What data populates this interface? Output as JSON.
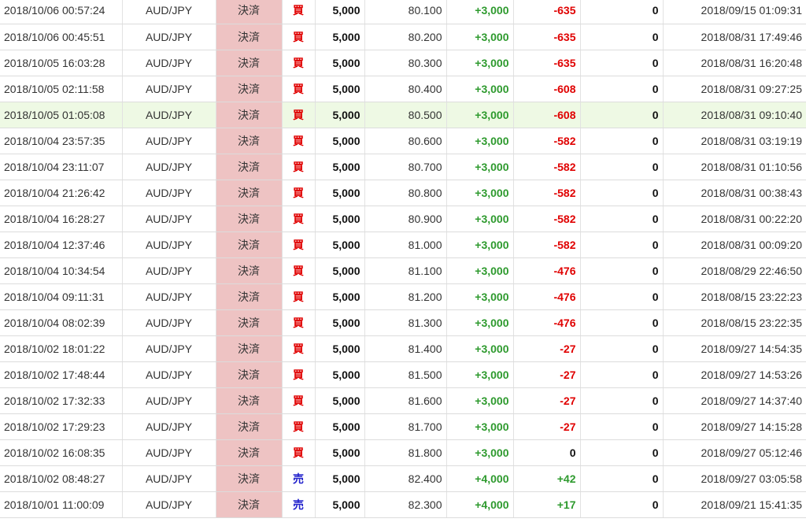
{
  "rows": [
    {
      "time": "2018/10/06 00:57:24",
      "pair": "AUD/JPY",
      "type": "決済",
      "side": "買",
      "qty": "5,000",
      "price": "80.100",
      "pips": "+3,000",
      "pl": "-635",
      "swap": "0",
      "open_time": "2018/09/15 01:09:31"
    },
    {
      "time": "2018/10/06 00:45:51",
      "pair": "AUD/JPY",
      "type": "決済",
      "side": "買",
      "qty": "5,000",
      "price": "80.200",
      "pips": "+3,000",
      "pl": "-635",
      "swap": "0",
      "open_time": "2018/08/31 17:49:46"
    },
    {
      "time": "2018/10/05 16:03:28",
      "pair": "AUD/JPY",
      "type": "決済",
      "side": "買",
      "qty": "5,000",
      "price": "80.300",
      "pips": "+3,000",
      "pl": "-635",
      "swap": "0",
      "open_time": "2018/08/31 16:20:48"
    },
    {
      "time": "2018/10/05 02:11:58",
      "pair": "AUD/JPY",
      "type": "決済",
      "side": "買",
      "qty": "5,000",
      "price": "80.400",
      "pips": "+3,000",
      "pl": "-608",
      "swap": "0",
      "open_time": "2018/08/31 09:27:25"
    },
    {
      "time": "2018/10/05 01:05:08",
      "pair": "AUD/JPY",
      "type": "決済",
      "side": "買",
      "qty": "5,000",
      "price": "80.500",
      "pips": "+3,000",
      "pl": "-608",
      "swap": "0",
      "open_time": "2018/08/31 09:10:40",
      "highlight": true
    },
    {
      "time": "2018/10/04 23:57:35",
      "pair": "AUD/JPY",
      "type": "決済",
      "side": "買",
      "qty": "5,000",
      "price": "80.600",
      "pips": "+3,000",
      "pl": "-582",
      "swap": "0",
      "open_time": "2018/08/31 03:19:19"
    },
    {
      "time": "2018/10/04 23:11:07",
      "pair": "AUD/JPY",
      "type": "決済",
      "side": "買",
      "qty": "5,000",
      "price": "80.700",
      "pips": "+3,000",
      "pl": "-582",
      "swap": "0",
      "open_time": "2018/08/31 01:10:56"
    },
    {
      "time": "2018/10/04 21:26:42",
      "pair": "AUD/JPY",
      "type": "決済",
      "side": "買",
      "qty": "5,000",
      "price": "80.800",
      "pips": "+3,000",
      "pl": "-582",
      "swap": "0",
      "open_time": "2018/08/31 00:38:43"
    },
    {
      "time": "2018/10/04 16:28:27",
      "pair": "AUD/JPY",
      "type": "決済",
      "side": "買",
      "qty": "5,000",
      "price": "80.900",
      "pips": "+3,000",
      "pl": "-582",
      "swap": "0",
      "open_time": "2018/08/31 00:22:20"
    },
    {
      "time": "2018/10/04 12:37:46",
      "pair": "AUD/JPY",
      "type": "決済",
      "side": "買",
      "qty": "5,000",
      "price": "81.000",
      "pips": "+3,000",
      "pl": "-582",
      "swap": "0",
      "open_time": "2018/08/31 00:09:20"
    },
    {
      "time": "2018/10/04 10:34:54",
      "pair": "AUD/JPY",
      "type": "決済",
      "side": "買",
      "qty": "5,000",
      "price": "81.100",
      "pips": "+3,000",
      "pl": "-476",
      "swap": "0",
      "open_time": "2018/08/29 22:46:50"
    },
    {
      "time": "2018/10/04 09:11:31",
      "pair": "AUD/JPY",
      "type": "決済",
      "side": "買",
      "qty": "5,000",
      "price": "81.200",
      "pips": "+3,000",
      "pl": "-476",
      "swap": "0",
      "open_time": "2018/08/15 23:22:23"
    },
    {
      "time": "2018/10/04 08:02:39",
      "pair": "AUD/JPY",
      "type": "決済",
      "side": "買",
      "qty": "5,000",
      "price": "81.300",
      "pips": "+3,000",
      "pl": "-476",
      "swap": "0",
      "open_time": "2018/08/15 23:22:35"
    },
    {
      "time": "2018/10/02 18:01:22",
      "pair": "AUD/JPY",
      "type": "決済",
      "side": "買",
      "qty": "5,000",
      "price": "81.400",
      "pips": "+3,000",
      "pl": "-27",
      "swap": "0",
      "open_time": "2018/09/27 14:54:35"
    },
    {
      "time": "2018/10/02 17:48:44",
      "pair": "AUD/JPY",
      "type": "決済",
      "side": "買",
      "qty": "5,000",
      "price": "81.500",
      "pips": "+3,000",
      "pl": "-27",
      "swap": "0",
      "open_time": "2018/09/27 14:53:26"
    },
    {
      "time": "2018/10/02 17:32:33",
      "pair": "AUD/JPY",
      "type": "決済",
      "side": "買",
      "qty": "5,000",
      "price": "81.600",
      "pips": "+3,000",
      "pl": "-27",
      "swap": "0",
      "open_time": "2018/09/27 14:37:40"
    },
    {
      "time": "2018/10/02 17:29:23",
      "pair": "AUD/JPY",
      "type": "決済",
      "side": "買",
      "qty": "5,000",
      "price": "81.700",
      "pips": "+3,000",
      "pl": "-27",
      "swap": "0",
      "open_time": "2018/09/27 14:15:28"
    },
    {
      "time": "2018/10/02 16:08:35",
      "pair": "AUD/JPY",
      "type": "決済",
      "side": "買",
      "qty": "5,000",
      "price": "81.800",
      "pips": "+3,000",
      "pl": "0",
      "swap": "0",
      "open_time": "2018/09/27 05:12:46"
    },
    {
      "time": "2018/10/02 08:48:27",
      "pair": "AUD/JPY",
      "type": "決済",
      "side": "売",
      "qty": "5,000",
      "price": "82.400",
      "pips": "+4,000",
      "pl": "+42",
      "swap": "0",
      "open_time": "2018/09/27 03:05:58"
    },
    {
      "time": "2018/10/01 11:00:09",
      "pair": "AUD/JPY",
      "type": "決済",
      "side": "売",
      "qty": "5,000",
      "price": "82.300",
      "pips": "+4,000",
      "pl": "+17",
      "swap": "0",
      "open_time": "2018/09/21 15:41:35"
    }
  ],
  "colors": {
    "type_cell_bg": "#eec3c3",
    "highlight_row_bg": "#eef9e4",
    "buy": "#e00000",
    "sell": "#2222cc",
    "positive": "#2e9a2e",
    "negative": "#e00000"
  }
}
